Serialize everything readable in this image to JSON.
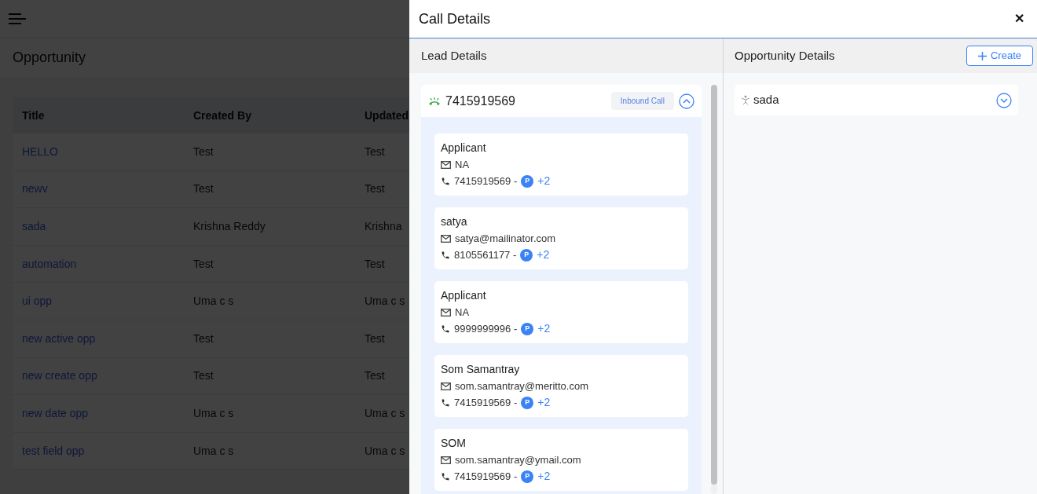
{
  "page": {
    "title": "Opportunity",
    "table": {
      "columns": [
        "Title",
        "Created By",
        "Updated"
      ],
      "rows": [
        [
          "HELLO",
          "Test",
          "Test"
        ],
        [
          "newv",
          "Test",
          "Test"
        ],
        [
          "sada",
          "Krishna Reddy",
          "Krishna"
        ],
        [
          "automation",
          "Test",
          "Test"
        ],
        [
          "ui opp",
          "Uma c s",
          "Uma c s"
        ],
        [
          "new active opp",
          "Test",
          "Test"
        ],
        [
          "new create opp",
          "Test",
          "Test"
        ],
        [
          "new date opp",
          "Uma c s",
          "Uma c s"
        ],
        [
          "test field opp",
          "Uma c s",
          "Uma c s"
        ]
      ]
    }
  },
  "drawer": {
    "title": "Call Details",
    "close": "✕",
    "lead": {
      "heading": "Lead Details",
      "phone": "7415919569",
      "call_type": "Inbound Call",
      "expanded": true,
      "contacts": [
        {
          "name": "Applicant",
          "email": "NA",
          "phone": "7415919569 -",
          "badge": "P",
          "more": "+2"
        },
        {
          "name": "satya",
          "email": "satya@mailinator.com",
          "phone": "8105561177 -",
          "badge": "P",
          "more": "+2"
        },
        {
          "name": "Applicant",
          "email": "NA",
          "phone": "9999999996 -",
          "badge": "P",
          "more": "+2"
        },
        {
          "name": "Som Samantray",
          "email": "som.samantray@meritto.com",
          "phone": "7415919569 -",
          "badge": "P",
          "more": "+2"
        },
        {
          "name": "SOM",
          "email": "som.samantray@ymail.com",
          "phone": "7415919569 -",
          "badge": "P",
          "more": "+2"
        }
      ]
    },
    "opportunity": {
      "heading": "Opportunity Details",
      "create": "Create",
      "items": [
        {
          "name": "sada",
          "expanded": false
        }
      ]
    }
  }
}
